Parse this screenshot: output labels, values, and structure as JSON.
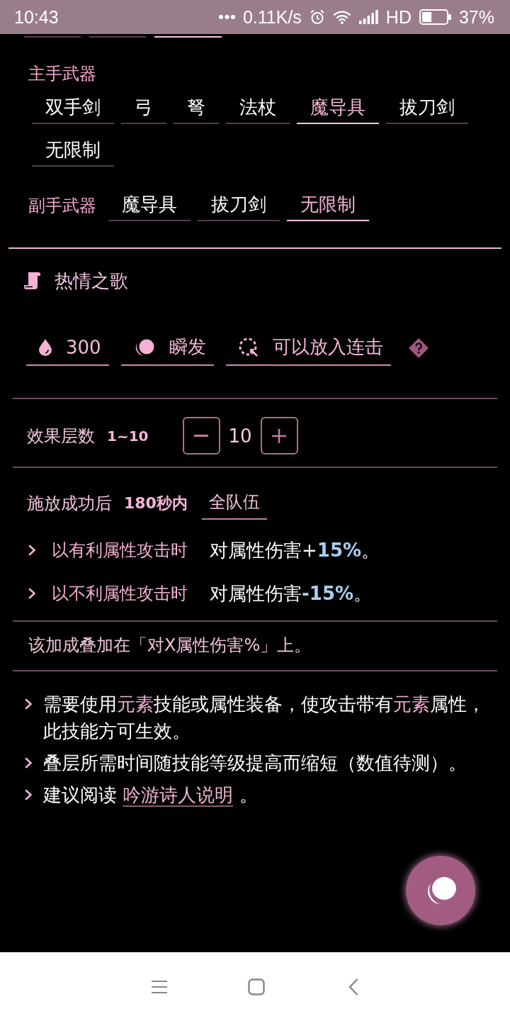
{
  "status_bar": {
    "time": "10:43",
    "net_speed": "0.11K/s",
    "network": "HD",
    "battery": "37%"
  },
  "scrolled_chips": [
    {
      "selected": false
    },
    {
      "selected": false
    },
    {
      "selected": true
    }
  ],
  "main_weapon": {
    "label": "主手武器",
    "options": [
      {
        "label": "双手剑",
        "selected": false
      },
      {
        "label": "弓",
        "selected": false
      },
      {
        "label": "弩",
        "selected": false
      },
      {
        "label": "法杖",
        "selected": false
      },
      {
        "label": "魔导具",
        "selected": true
      },
      {
        "label": "拔刀剑",
        "selected": false
      },
      {
        "label": "无限制",
        "selected": false
      }
    ]
  },
  "sub_weapon": {
    "label": "副手武器",
    "options": [
      {
        "label": "魔导具",
        "selected": false
      },
      {
        "label": "拔刀剑",
        "selected": false
      },
      {
        "label": "无限制",
        "selected": true
      }
    ]
  },
  "skill": {
    "title": "热情之歌",
    "tags": [
      {
        "kind": "mp",
        "label": "300"
      },
      {
        "kind": "cast",
        "label": "瞬发"
      },
      {
        "kind": "combo",
        "label": "可以放入连击"
      }
    ]
  },
  "stacks": {
    "label": "效果层数",
    "range": "1~10",
    "value": "10"
  },
  "effect": {
    "trigger": "施放成功后",
    "duration": "180秒内",
    "target": "全队伍",
    "conditions": [
      {
        "condition": "以有利属性攻击时",
        "result": "对属性伤害+**15%**。"
      },
      {
        "condition": "以不利属性攻击时",
        "result": "对属性伤害**-15%**。"
      }
    ]
  },
  "stack_note": "该加成叠加在「对X属性伤害%」上。",
  "notes": [
    {
      "text": "需要使用**元素**技能或属性装备，使攻击带有**元素**属性，此技能方可生效。"
    },
    {
      "text": "叠层所需时间随技能等级提高而缩短（数值待测）。"
    },
    {
      "text": "建议阅读",
      "link": "吟游诗人说明",
      "after": "。"
    }
  ]
}
